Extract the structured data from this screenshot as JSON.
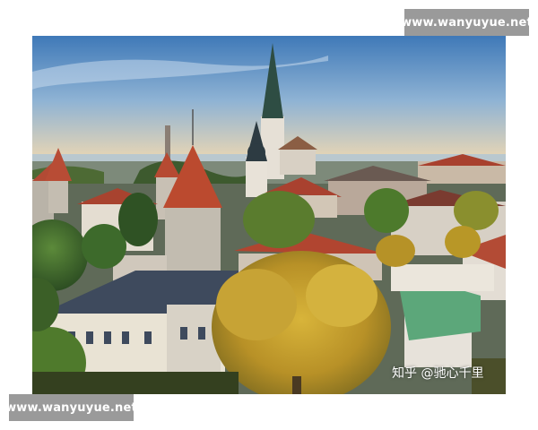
{
  "photo": {
    "subject": "city-panorama",
    "colors": {
      "sky_top": "#4a82bd",
      "sky_horizon": "#f1d9b1",
      "roof_red": "#b84a32",
      "tower_stone": "#c9c3b8",
      "foliage_green": "#3f6a2c",
      "foliage_yellow": "#c9a42a",
      "copper_roof": "#5fa77c",
      "slate_roof": "#3f4a5c"
    }
  },
  "watermarks": {
    "top": "www.wanyuyue.net",
    "bottom": "www.wanyuyue.net"
  },
  "credit": "知乎 @驰心千里"
}
